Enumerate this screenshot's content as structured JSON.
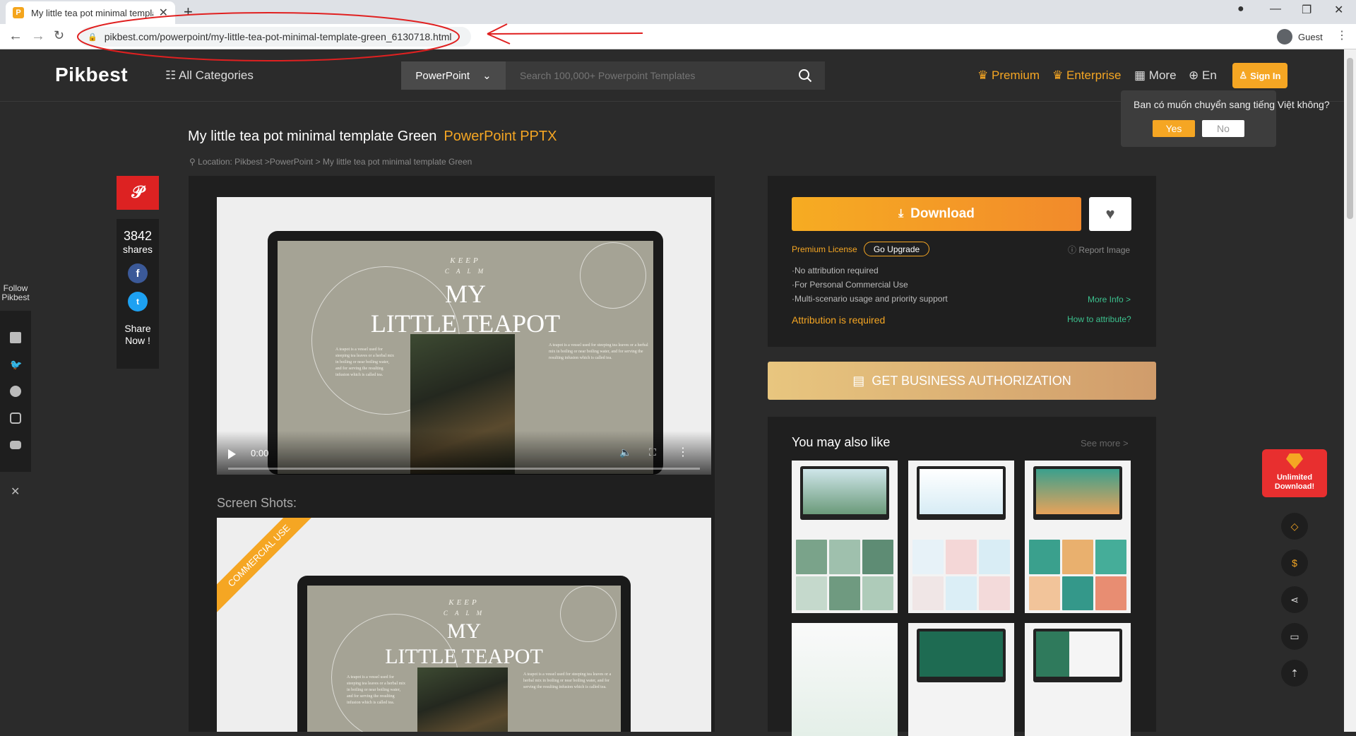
{
  "browser": {
    "tab_title": "My little tea pot minimal template Green",
    "favicon_letter": "P",
    "url": "pikbest.com/powerpoint/my-little-tea-pot-minimal-template-green_6130718.html",
    "profile": "Guest"
  },
  "header": {
    "logo": "Pikbest",
    "all_categories": "All Categories",
    "search_type": "PowerPoint",
    "search_placeholder": "Search 100,000+ Powerpoint Templates",
    "premium": "Premium",
    "enterprise": "Enterprise",
    "more": "More",
    "language": "En",
    "sign_in": "Sign In"
  },
  "lang_popup": {
    "question": "Ban có muốn chuyển sang tiếng Việt không?",
    "yes": "Yes",
    "no": "No"
  },
  "page": {
    "title": "My little tea pot minimal template Green",
    "format": "PowerPoint PPTX",
    "breadcrumb": "Location: Pikbest >PowerPoint >  My little tea pot minimal template Green"
  },
  "share": {
    "count": "3842",
    "count_label": "shares",
    "share_now_1": "Share",
    "share_now_2": "Now !"
  },
  "follow": {
    "label_1": "Follow",
    "label_2": "Pikbest"
  },
  "preview": {
    "slide_keep": "KEEP",
    "slide_calm": "C A L M",
    "slide_my": "MY",
    "slide_title": "LITTLE TEAPOT",
    "slide_text": "A teapot is a vessel used for steeping tea leaves or a herbal mix in boiling or near boiling water, and for serving the resulting infusion which is called tea.",
    "video_time": "0:00",
    "screenshots_label": "Screen Shots:",
    "ribbon": "COMMERCIAL USE"
  },
  "download": {
    "button": "Download",
    "license": "Premium License",
    "upgrade": "Go Upgrade",
    "report": "Report Image",
    "features": [
      "·No attribution required",
      "·For Personal Commercial Use",
      "·Multi-scenario usage and priority support"
    ],
    "more_info": "More Info >",
    "attribution": "Attribution is required",
    "how_to": "How to attribute?"
  },
  "business": {
    "label": "GET BUSINESS AUTHORIZATION"
  },
  "related": {
    "title": "You may also like",
    "see_more": "See more >"
  },
  "tools": {
    "unlimited_1": "Unlimited",
    "unlimited_2": "Download!"
  }
}
